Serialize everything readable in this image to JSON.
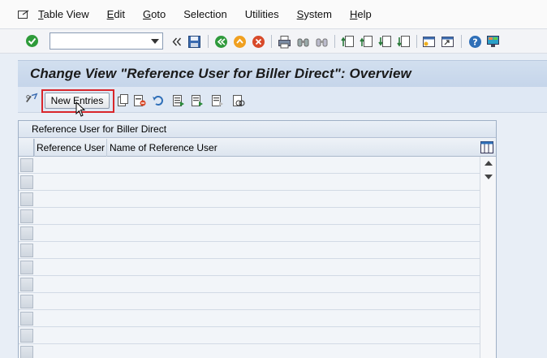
{
  "menu": {
    "items": [
      {
        "label": "Table View",
        "key": "T",
        "rest": "able View"
      },
      {
        "label": "Edit",
        "key": "E",
        "rest": "dit"
      },
      {
        "label": "Goto",
        "key": "G",
        "rest": "oto"
      },
      {
        "label": "Selection",
        "key": "",
        "rest": "Selection"
      },
      {
        "label": "Utilities",
        "key": "",
        "rest": "Utilities"
      },
      {
        "label": "System",
        "key": "S",
        "rest": "ystem"
      },
      {
        "label": "Help",
        "key": "H",
        "rest": "elp"
      }
    ]
  },
  "toolbar": {
    "command_field_value": "",
    "icons": [
      "enter-check-icon",
      "back-double-arrow-icon",
      "save-icon",
      "back-icon",
      "exit-icon",
      "cancel-icon",
      "print-icon",
      "find-icon",
      "find-next-icon",
      "first-page-icon",
      "previous-page-icon",
      "next-page-icon",
      "last-page-icon",
      "create-session-icon",
      "shortcut-icon",
      "help-icon",
      "layout-icon"
    ]
  },
  "title": {
    "text": "Change View \"Reference User for Biller Direct\": Overview"
  },
  "app_toolbar": {
    "new_entries_label": "New Entries",
    "icons": [
      "display-change-icon",
      "copy-as-icon",
      "delete-icon",
      "undo-change-icon",
      "select-all-icon",
      "select-block-icon",
      "deselect-all-icon",
      "variant-icon"
    ]
  },
  "table": {
    "title": "Reference User for Biller Direct",
    "columns": [
      "Reference User",
      "Name of Reference User"
    ],
    "rows": [
      [
        "",
        ""
      ],
      [
        "",
        ""
      ],
      [
        "",
        ""
      ],
      [
        "",
        ""
      ],
      [
        "",
        ""
      ],
      [
        "",
        ""
      ],
      [
        "",
        ""
      ],
      [
        "",
        ""
      ],
      [
        "",
        ""
      ],
      [
        "",
        ""
      ],
      [
        "",
        ""
      ],
      [
        "",
        ""
      ]
    ]
  },
  "colors": {
    "highlight_border": "#d9262b",
    "title_bar": "#c9d8ec",
    "background": "#e8eef6"
  }
}
